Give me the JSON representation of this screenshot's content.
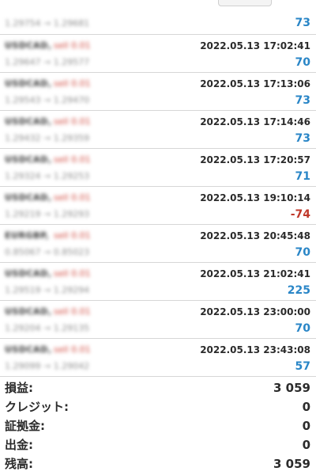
{
  "top_row": {
    "prices": "1.29754 → 1.29681",
    "profit": "73",
    "profit_sign": "pos"
  },
  "trades": [
    {
      "symbol": "USDCAD,",
      "side": "sell 0.01",
      "prices": "1.29647 → 1.29577",
      "time": "2022.05.13 17:02:41",
      "profit": "70",
      "profit_sign": "pos"
    },
    {
      "symbol": "USDCAD,",
      "side": "sell 0.01",
      "prices": "1.29543 → 1.29470",
      "time": "2022.05.13 17:13:06",
      "profit": "73",
      "profit_sign": "pos"
    },
    {
      "symbol": "USDCAD,",
      "side": "sell 0.01",
      "prices": "1.29432 → 1.29359",
      "time": "2022.05.13 17:14:46",
      "profit": "73",
      "profit_sign": "pos"
    },
    {
      "symbol": "USDCAD,",
      "side": "sell 0.01",
      "prices": "1.29324 → 1.29253",
      "time": "2022.05.13 17:20:57",
      "profit": "71",
      "profit_sign": "pos"
    },
    {
      "symbol": "USDCAD,",
      "side": "sell 0.01",
      "prices": "1.29219 → 1.29293",
      "time": "2022.05.13 19:10:14",
      "profit": "-74",
      "profit_sign": "neg"
    },
    {
      "symbol": "EURGBP,",
      "side": "sell 0.01",
      "prices": "0.85067 → 0.85023",
      "time": "2022.05.13 20:45:48",
      "profit": "70",
      "profit_sign": "pos"
    },
    {
      "symbol": "USDCAD,",
      "side": "sell 0.01",
      "prices": "1.29519 → 1.29294",
      "time": "2022.05.13 21:02:41",
      "profit": "225",
      "profit_sign": "pos"
    },
    {
      "symbol": "USDCAD,",
      "side": "sell 0.01",
      "prices": "1.29204 → 1.29135",
      "time": "2022.05.13 23:00:00",
      "profit": "70",
      "profit_sign": "pos"
    },
    {
      "symbol": "USDCAD,",
      "side": "sell 0.01",
      "prices": "1.29099 → 1.29042",
      "time": "2022.05.13 23:43:08",
      "profit": "57",
      "profit_sign": "pos"
    }
  ],
  "summary": [
    {
      "label": "損益:",
      "value": "3 059"
    },
    {
      "label": "クレジット:",
      "value": "0"
    },
    {
      "label": "証拠金:",
      "value": "0"
    },
    {
      "label": "出金:",
      "value": "0"
    },
    {
      "label": "残高:",
      "value": "3 059"
    }
  ],
  "colors": {
    "profit_positive": "#2a86c7",
    "profit_negative": "#c0392b",
    "side_sell": "#d0453a"
  }
}
